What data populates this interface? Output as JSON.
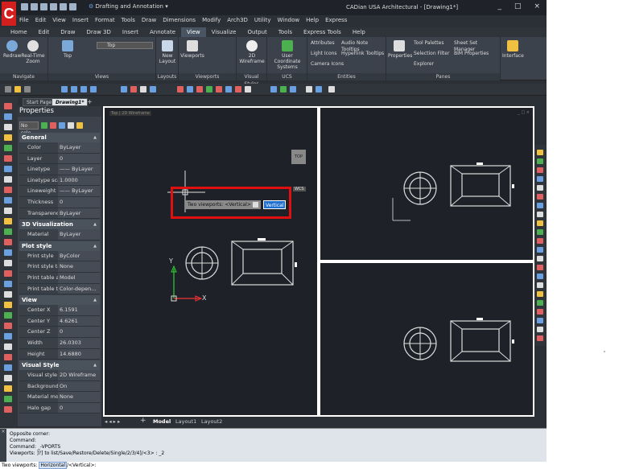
{
  "titlebar": {
    "logo": "C",
    "workspace": "Drafting and Annotation",
    "title": "CADian USA Architectural - [Drawing1*]",
    "minimize": "_",
    "maximize": "□",
    "close": "×"
  },
  "menubar": [
    "File",
    "Edit",
    "View",
    "Insert",
    "Format",
    "Tools",
    "Draw",
    "Dimensions",
    "Modify",
    "Arch3D",
    "Utility",
    "Window",
    "Help",
    "Express"
  ],
  "ribbon_tabs": [
    "Home",
    "Edit",
    "Draw",
    "Draw 3D",
    "Insert",
    "Annotate",
    "View",
    "Visualize",
    "Output",
    "Tools",
    "Express Tools",
    "Help"
  ],
  "ribbon_active_tab": "View",
  "ribbon": {
    "navigate": {
      "label": "Navigate",
      "redraw": "Redraw",
      "realtime_zoom": "Real-Time Zoom"
    },
    "views": {
      "label": "Views",
      "top": "Top",
      "combo": "Top"
    },
    "layouts": {
      "label": "Layouts",
      "new_layout": "New Layout"
    },
    "viewports": {
      "label": "Viewports",
      "viewports": "Viewports"
    },
    "visual_styles": {
      "label": "Visual Styles",
      "wireframe": "2D Wireframe"
    },
    "ucs": {
      "label": "UCS",
      "user_coord": "User Coordinate Systems"
    },
    "entities": {
      "label": "Entities",
      "attributes": "Attributes",
      "audio_note": "Audio Note Tooltips",
      "light_icons": "Light Icons",
      "hyperlink": "Hyperlink Tooltips",
      "camera_icons": "Camera Icons"
    },
    "panes": {
      "label": "Panes",
      "properties": "Properties",
      "tool_palettes": "Tool Palettes",
      "sheet_set": "Sheet Set Manager",
      "selection_filter": "Selection Filter",
      "bim_properties": "BIM Properties",
      "explorer": "Explorer"
    },
    "interface": {
      "label": "Interface"
    }
  },
  "doc_tabs": [
    "Start Page",
    "Drawing1*"
  ],
  "properties": {
    "title": "Properties",
    "selection": "No sele",
    "sections": [
      {
        "name": "General",
        "rows": [
          [
            "Color",
            "ByLayer"
          ],
          [
            "Layer",
            "0"
          ],
          [
            "Linetype",
            "—— ByLayer"
          ],
          [
            "Linetype scale",
            "1.0000"
          ],
          [
            "Lineweight",
            "—— ByLayer"
          ],
          [
            "Thickness",
            "0"
          ],
          [
            "Transparency",
            "ByLayer"
          ]
        ]
      },
      {
        "name": "3D Visualization",
        "rows": [
          [
            "Material",
            "ByLayer"
          ]
        ]
      },
      {
        "name": "Plot style",
        "rows": [
          [
            "Print style",
            "ByColor"
          ],
          [
            "Print style ta...",
            "None"
          ],
          [
            "Print table at...",
            "Model"
          ],
          [
            "Print table type",
            "Color-depen..."
          ]
        ]
      },
      {
        "name": "View",
        "rows": [
          [
            "Center X",
            "6.1591"
          ],
          [
            "Center Y",
            "4.6261"
          ],
          [
            "Center Z",
            "0"
          ],
          [
            "Width",
            "26.0303"
          ],
          [
            "Height",
            "14.6880"
          ]
        ]
      },
      {
        "name": "Visual Style",
        "rows": [
          [
            "Visual style",
            "2D Wireframe"
          ],
          [
            "Background",
            "On"
          ],
          [
            "Material mode",
            "None"
          ],
          [
            "Halo gap",
            "0"
          ]
        ]
      }
    ]
  },
  "viewport": {
    "label1": "Top",
    "label2": "2D Wireframe",
    "viewcube": "TOP",
    "wcs": "WCS",
    "axis_x": "X",
    "axis_y": "Y"
  },
  "tooltip": {
    "text": "Two viewports:  <Vertical>",
    "input": "Vertical"
  },
  "layout_tabs": [
    "Model",
    "Layout1",
    "Layout2"
  ],
  "command": {
    "lines": [
      "Opposite corner:",
      "Command:",
      "Command: _-VPORTS",
      "Viewports: ]?] to list/Save/Restore/Delete/Single/2/3/4]/<3> : _2"
    ],
    "prompt_prefix": "Two viewports:",
    "prompt_highlight": "Horizontal",
    "prompt_suffix": "/<Vertical>:"
  },
  "colors": {
    "accent_red": "#e01010",
    "highlight_blue": "#1f6fd1",
    "ui_dark": "#2b2f36"
  }
}
